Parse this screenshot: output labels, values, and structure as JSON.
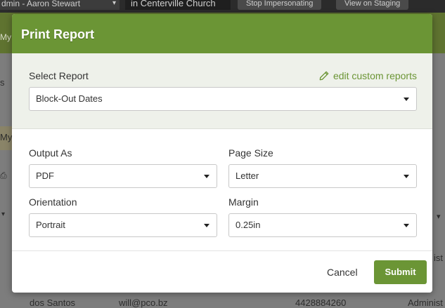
{
  "background": {
    "user": "dmin - Aaron Stewart",
    "church": "in Centerville Church",
    "stop_impersonating": "Stop Impersonating",
    "view_on_staging": "View on Staging",
    "green_fragment": "My",
    "fragment_s": "s",
    "fragment_my": "My",
    "row_name": "dos Santos",
    "row_email": "will@pco.bz",
    "row_phone": "4428884260",
    "row_role": "Administ",
    "ist_fragment": "ist"
  },
  "modal": {
    "title": "Print Report",
    "select_report_label": "Select Report",
    "edit_link": "edit custom reports",
    "report_value": "Block-Out Dates",
    "output_as_label": "Output As",
    "output_as_value": "PDF",
    "page_size_label": "Page Size",
    "page_size_value": "Letter",
    "orientation_label": "Orientation",
    "orientation_value": "Portrait",
    "margin_label": "Margin",
    "margin_value": "0.25in",
    "cancel": "Cancel",
    "submit": "Submit"
  },
  "colors": {
    "accent": "#6b9535",
    "overlay": "#7d7d7d"
  }
}
